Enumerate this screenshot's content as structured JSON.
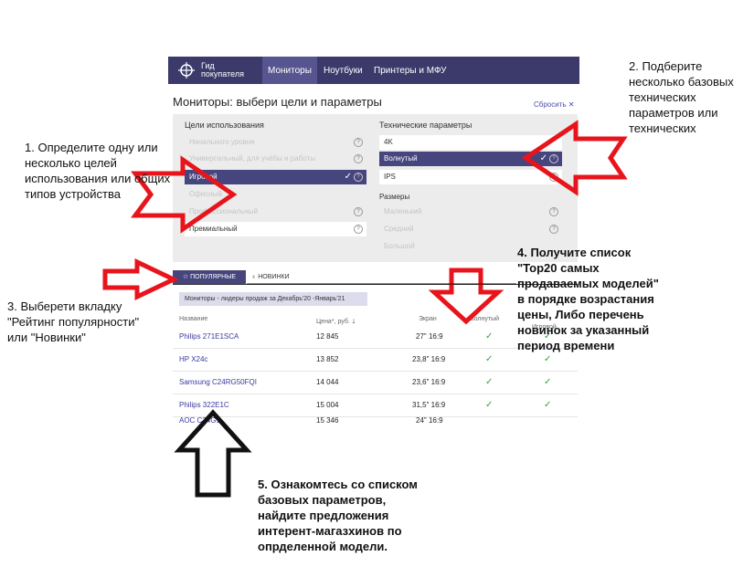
{
  "header": {
    "logo_line1": "Гид",
    "logo_line2": "покупателя",
    "tabs": [
      {
        "label": "Мониторы",
        "active": true
      },
      {
        "label": "Ноутбуки",
        "active": false
      },
      {
        "label": "Принтеры и МФУ",
        "active": false
      }
    ]
  },
  "page": {
    "title": "Мониторы: выбери цели и параметры",
    "reset_label": "Сбросить ✕"
  },
  "filters": {
    "usage_title": "Цели использования",
    "usage": [
      {
        "label": "Начального уровня"
      },
      {
        "label": "Универсальный, для учёбы и работы"
      },
      {
        "label": "Игровой"
      },
      {
        "label": "Офисный"
      },
      {
        "label": "Профессиональный"
      },
      {
        "label": "Премиальный"
      }
    ],
    "tech_title": "Технические параметры",
    "tech": [
      {
        "label": "4K"
      },
      {
        "label": "Волнутый"
      },
      {
        "label": "IPS"
      }
    ],
    "size_title": "Размеры",
    "sizes": [
      {
        "label": "Маленький"
      },
      {
        "label": "Средний"
      },
      {
        "label": "Большой"
      }
    ]
  },
  "tabs": {
    "popular": "ПОПУЛЯРНЫЕ",
    "new": "НОВИНКИ"
  },
  "leaders_label": "Мониторы - лидеры продаж за Декабрь'20 -Январь'21",
  "table": {
    "headers": {
      "name": "Название",
      "price": "Цена*, руб.",
      "screen": "Экран",
      "curved": "Волнутый",
      "gaming": "Игровой"
    },
    "rows": [
      {
        "name": "Philips 271E1SCA",
        "price": "12 845",
        "screen": "27\" 16:9"
      },
      {
        "name": "HP X24c",
        "price": "13 852",
        "screen": "23,8\" 16:9"
      },
      {
        "name": "Samsung C24RG50FQI",
        "price": "14 044",
        "screen": "23,6\" 16:9"
      },
      {
        "name": "Philips 322E1C",
        "price": "15 004",
        "screen": "31,5\" 16:9"
      },
      {
        "name": "AOC C24G1",
        "price": "15 346",
        "screen": "24\" 16:9"
      }
    ]
  },
  "annotations": {
    "n1": "1. Определите одну или несколько целей использования или общих типов устройства",
    "n2": "2. Подберите несколько базовых технических параметров или технических",
    "n3": "3. Выберети вкладку \"Рейтинг популярности\" или \"Новинки\"",
    "n4": "4. Получите список \"Top20 самых продаваемых моделей\" в порядке возрастания цены, Либо перечень новинок за указанный период времени",
    "n5": "5. Ознакомтесь со списком базовых параметров, найдите предложения интерент-магазхинов по опрделенной модели."
  },
  "colors": {
    "nav": "#3b3a6b",
    "selected": "#46457e",
    "arrow_red": "#e8141c",
    "check": "#2aa53f"
  }
}
